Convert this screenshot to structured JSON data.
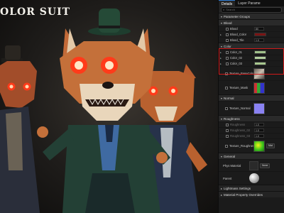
{
  "scene": {
    "title": "OLOR SUIT"
  },
  "panel": {
    "tabs": [
      {
        "label": "Details",
        "active": true
      },
      {
        "label": "Layer Parame",
        "active": false
      }
    ],
    "search_placeholder": "Search",
    "groups": {
      "parameter_groups": "Parameter Groups",
      "blood": {
        "label": "Blood",
        "rows": [
          {
            "label": "Blood",
            "value": "80"
          },
          {
            "label": "Blood_Color",
            "value": ""
          },
          {
            "label": "Blood_Tile",
            "value": "1.0"
          }
        ]
      },
      "color": {
        "label": "Color",
        "rows": [
          {
            "label": "Color_01",
            "color": "#9fc08a"
          },
          {
            "label": "Color_02",
            "color": "#b2ce9d"
          },
          {
            "label": "Color_03",
            "color": "#a8c78f"
          }
        ],
        "textures": [
          {
            "label": "Texture_BaseColor"
          },
          {
            "label": "Texture_Mask"
          }
        ]
      },
      "normal": {
        "label": "Normal",
        "textures": [
          {
            "label": "Texture_Normal"
          }
        ]
      },
      "roughness": {
        "label": "Roughness",
        "rows": [
          {
            "label": "Roughness",
            "value": "1.0"
          },
          {
            "label": "Roughness_02",
            "value": "1.0"
          },
          {
            "label": "Roughness_03",
            "value": "1.0"
          }
        ],
        "textures": [
          {
            "label": "Texture_Roughness"
          }
        ]
      },
      "general": {
        "label": "General",
        "phys_material": "Phys Material",
        "phys_value": "None",
        "parent": "Parent",
        "lightmass": "Lightmass Settings",
        "material_overrides": "Material Property Overrides",
        "dropdown": "Mat"
      }
    }
  },
  "colors": {
    "highlight": "#d21a1a",
    "accent": "#2f7fd9"
  }
}
